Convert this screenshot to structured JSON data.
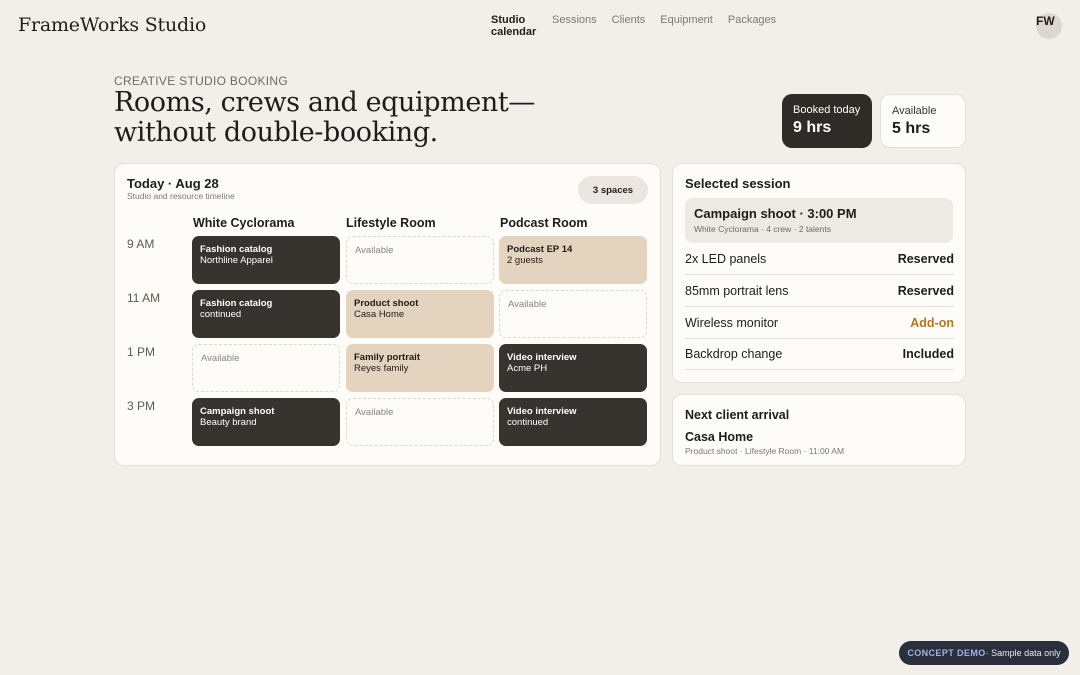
{
  "header": {
    "brand": "FrameWorks Studio",
    "nav": [
      {
        "label": "Studio calendar",
        "active": true
      },
      {
        "label": "Sessions"
      },
      {
        "label": "Clients"
      },
      {
        "label": "Equipment"
      },
      {
        "label": "Packages"
      }
    ],
    "avatar_initials": "FW"
  },
  "hero": {
    "eyebrow": "CREATIVE STUDIO BOOKING",
    "headline": "Rooms, crews and equipment—without double-booking.",
    "stats": [
      {
        "label": "Booked today",
        "value": "9 hrs"
      },
      {
        "label": "Available",
        "value": "5 hrs"
      }
    ]
  },
  "calendar": {
    "title": "Today · Aug 28",
    "subtitle": "Studio and resource timeline",
    "spaces_label": "3 spaces",
    "rooms": [
      "White Cyclorama",
      "Lifestyle Room",
      "Podcast Room"
    ],
    "times": [
      "9 AM",
      "11 AM",
      "1 PM",
      "3 PM"
    ],
    "slots": [
      [
        {
          "title": "Fashion catalog",
          "subtitle": "Northline Apparel",
          "style": "dark"
        },
        {
          "title": "",
          "subtitle": "Available",
          "style": "avail"
        },
        {
          "title": "Podcast EP 14",
          "subtitle": "2 guests",
          "style": "tan"
        }
      ],
      [
        {
          "title": "Fashion catalog",
          "subtitle": "continued",
          "style": "dark"
        },
        {
          "title": "Product shoot",
          "subtitle": "Casa Home",
          "style": "tan"
        },
        {
          "title": "",
          "subtitle": "Available",
          "style": "avail"
        }
      ],
      [
        {
          "title": "",
          "subtitle": "Available",
          "style": "avail"
        },
        {
          "title": "Family portrait",
          "subtitle": "Reyes family",
          "style": "tan"
        },
        {
          "title": "Video interview",
          "subtitle": "Acme PH",
          "style": "dark"
        }
      ],
      [
        {
          "title": "Campaign shoot",
          "subtitle": "Beauty brand",
          "style": "dark"
        },
        {
          "title": "",
          "subtitle": "Available",
          "style": "avail"
        },
        {
          "title": "Video interview",
          "subtitle": "continued",
          "style": "dark"
        }
      ]
    ]
  },
  "selected": {
    "title": "Selected session",
    "session_name": "Campaign shoot · 3:00 PM",
    "session_meta": "White Cyclorama · 4 crew · 2 talents",
    "items": [
      {
        "label": "2x LED panels",
        "value": "Reserved"
      },
      {
        "label": "85mm portrait lens",
        "value": "Reserved"
      },
      {
        "label": "Wireless monitor",
        "value": "Add-on"
      },
      {
        "label": "Backdrop change",
        "value": "Included"
      }
    ],
    "addon_color": "#b07a1e"
  },
  "next_client": {
    "title": "Next client arrival",
    "name": "Casa Home",
    "meta": "Product shoot · Lifestyle Room · 11:00 AM"
  },
  "badge": {
    "tag": "CONCEPT DEMO",
    "text": " · Sample data only"
  }
}
